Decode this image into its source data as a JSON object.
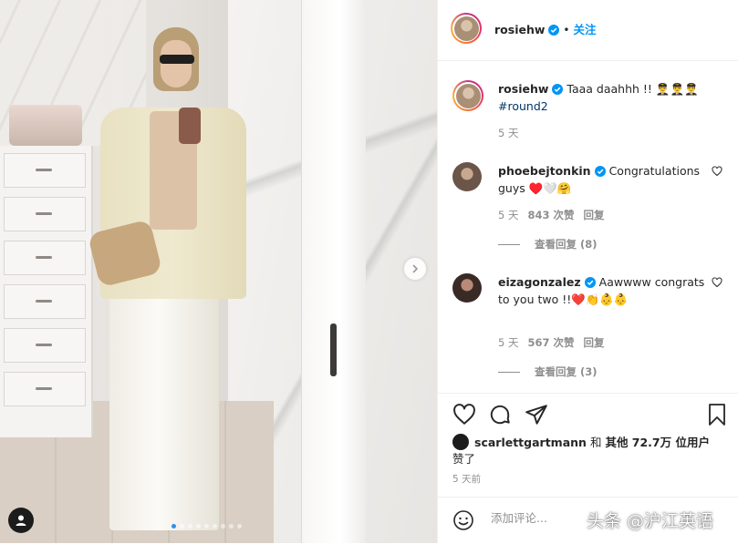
{
  "post": {
    "username": "rosiehw",
    "follow_label": "关注",
    "separator": "•"
  },
  "caption": {
    "username": "rosiehw",
    "text": "Taaa daahhh !! 👨‍✈️👨‍✈️👨‍✈️",
    "hashtag": "#round2",
    "time": "5 天"
  },
  "comments": [
    {
      "username": "phoebejtonkin",
      "text": "Congratulations guys ♥️🤍🤗",
      "time": "5 天",
      "likes": "843 次赞",
      "reply": "回复",
      "view_replies": "查看回复 (8)"
    },
    {
      "username": "eizagonzalez",
      "text": "Aawwww congrats to you two !!❤️👏👶👶",
      "time": "5 天",
      "likes": "567 次赞",
      "reply": "回复",
      "view_replies": "查看回复 (3)"
    }
  ],
  "likes": {
    "user": "scarlettgartmann",
    "and": "和",
    "others": "其他 72.7万 位用户",
    "suffix": "赞了"
  },
  "timestamp": "5 天前",
  "comment_input": {
    "placeholder": "添加评论..."
  },
  "watermark": "头条 @沪江英语",
  "carousel": {
    "count": 9,
    "active_index": 0
  },
  "colors": {
    "accent": "#0095f6",
    "text": "#262626",
    "secondary": "#8e8e8e",
    "heart_red": "#ed4956"
  }
}
